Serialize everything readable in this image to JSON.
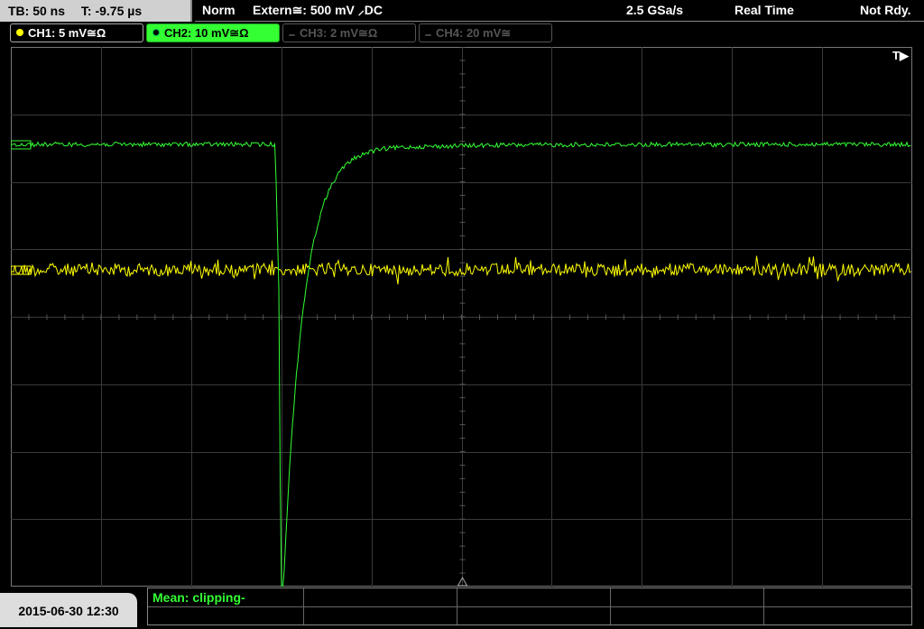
{
  "topbar": {
    "timebase": "TB: 50 ns",
    "trigger_time": "T: -9.75 µs",
    "acq_mode": "Norm",
    "trigger_source": "Extern≅: 500 mV ⸝DC",
    "sample_rate": "2.5 GSa/s",
    "mode": "Real Time",
    "status": "Not Rdy."
  },
  "channels": [
    {
      "label": "CH1: 5 mV≅Ω",
      "color": "#ffff00",
      "active": true
    },
    {
      "label": "CH2: 10 mV≅Ω",
      "color": "#33ff33",
      "active": true,
      "selected": true
    },
    {
      "label": "CH3: 2 mV≅Ω",
      "color": "#555555",
      "active": false
    },
    {
      "label": "CH4: 20 mV≅",
      "color": "#555555",
      "active": false
    }
  ],
  "grid": {
    "trigger_marker": "T▶",
    "ch_markers": [
      "CH1",
      "CH2"
    ]
  },
  "bottombar": {
    "datetime": "2015-06-30 12:30",
    "measurement": "Mean: clipping-"
  }
}
